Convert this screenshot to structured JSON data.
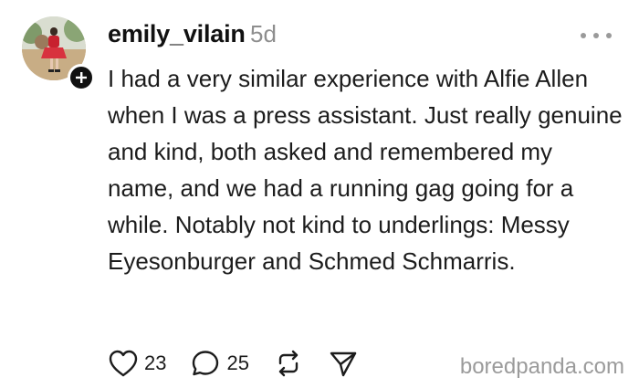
{
  "post": {
    "username": "emily_vilain",
    "timestamp": "5d",
    "text": "I had a very similar experience with Alfie Allen when I was a press assistant. Just really genuine and kind, both asked and remembered my name, and we had a running gag going for a while. Notably not kind to underlings: Messy Eyesonburger and Schmed Schmarris.",
    "avatar_icon": "avatar-photo",
    "follow_icon": "plus-icon",
    "more_icon": "more-dots-icon"
  },
  "actions": {
    "like": {
      "icon": "heart-icon",
      "count": "23"
    },
    "reply": {
      "icon": "comment-icon",
      "count": "25"
    },
    "repost": {
      "icon": "repost-icon"
    },
    "share": {
      "icon": "send-icon"
    }
  },
  "watermark": "boredpanda.com",
  "colors": {
    "text": "#1c1c1c",
    "muted": "#8e8e8e",
    "badge": "#111111",
    "background": "#ffffff"
  }
}
